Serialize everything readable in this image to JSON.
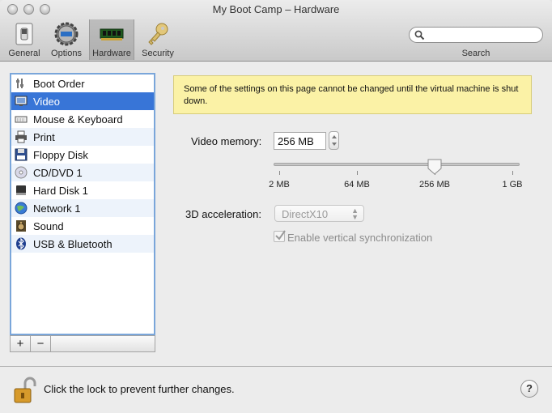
{
  "window": {
    "title": "My Boot Camp – Hardware"
  },
  "toolbar": {
    "buttons": [
      {
        "label": "General",
        "icon": "switch-icon"
      },
      {
        "label": "Options",
        "icon": "gear-icon"
      },
      {
        "label": "Hardware",
        "icon": "chip-icon",
        "selected": true
      },
      {
        "label": "Security",
        "icon": "key-icon"
      }
    ],
    "search_placeholder": "",
    "search_label": "Search"
  },
  "sidebar": {
    "items": [
      {
        "label": "Boot Order",
        "icon": "boot-order-icon"
      },
      {
        "label": "Video",
        "icon": "monitor-icon",
        "selected": true
      },
      {
        "label": "Mouse & Keyboard",
        "icon": "keyboard-icon"
      },
      {
        "label": "Print",
        "icon": "printer-icon"
      },
      {
        "label": "Floppy Disk",
        "icon": "floppy-disk-icon"
      },
      {
        "label": "CD/DVD 1",
        "icon": "cd-dvd-icon"
      },
      {
        "label": "Hard Disk 1",
        "icon": "hard-disk-icon"
      },
      {
        "label": "Network 1",
        "icon": "network-globe-icon"
      },
      {
        "label": "Sound",
        "icon": "speaker-icon"
      },
      {
        "label": "USB & Bluetooth",
        "icon": "bluetooth-icon"
      }
    ],
    "add_label": "+",
    "remove_label": "−"
  },
  "video": {
    "notice": "Some of the settings on this page cannot be changed until the virtual machine is shut down.",
    "memory_label": "Video memory:",
    "memory_value": "256 MB",
    "slider_ticks": [
      "2 MB",
      "64 MB",
      "256 MB",
      "1 GB"
    ],
    "slider_value_index": 2,
    "accel_label": "3D acceleration:",
    "accel_value": "DirectX10",
    "vsync_label": "Enable vertical synchronization",
    "vsync_checked": true
  },
  "footer": {
    "lock_text": "Click the lock to prevent further changes.",
    "help_label": "?"
  },
  "colors": {
    "selection": "#3875d7",
    "notice_bg": "#fbf2a6",
    "list_border": "#7aa6da"
  }
}
